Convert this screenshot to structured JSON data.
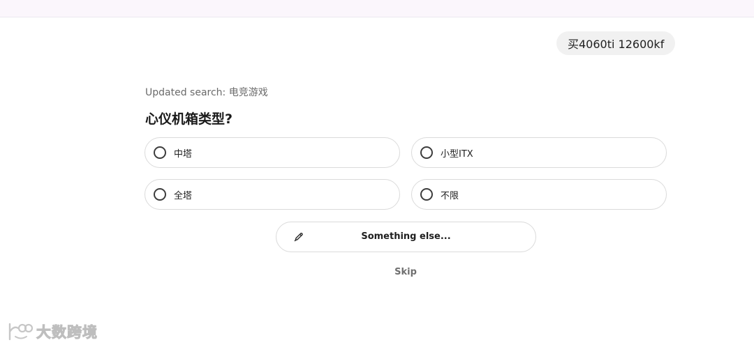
{
  "user_message": "买4060ti 12600kf",
  "updated_search": "Updated search: 电竞游戏",
  "question": "心仪机箱类型?",
  "options": [
    {
      "label": "中塔"
    },
    {
      "label": "小型ITX"
    },
    {
      "label": "全塔"
    },
    {
      "label": "不限"
    }
  ],
  "something_else": {
    "label": "Something else...",
    "icon": "pencil-icon"
  },
  "skip_label": "Skip",
  "watermark": {
    "text": "大数跨境",
    "icon": "watermark-logo-icon"
  }
}
